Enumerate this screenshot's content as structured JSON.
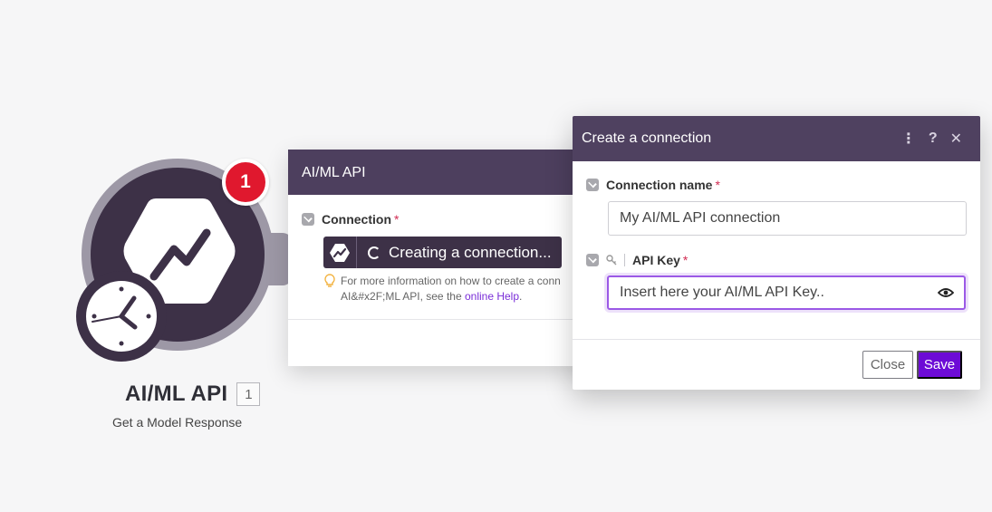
{
  "module": {
    "title": "AI/ML API",
    "subtitle": "Get a Model Response",
    "badge": "1",
    "count": "1",
    "icon": "aiml-hexagon-icon",
    "clock_icon": "clock-icon"
  },
  "panel": {
    "title": "AI/ML API",
    "connection_label": "Connection",
    "required_mark": "*",
    "connection_status": "Creating a connection...",
    "hint_text": "For more information on how to create a conn",
    "hint_text_2": "AI&#x2F;ML API, see the ",
    "hint_link": "online Help",
    "hint_end": "."
  },
  "dialog": {
    "title": "Create a connection",
    "connection_name_label": "Connection name",
    "connection_name_value": "My AI/ML API connection",
    "api_key_label": "API Key",
    "api_key_placeholder": "Insert here your AI/ML API Key..",
    "close_label": "Close",
    "save_label": "Save",
    "menu_icon": "⋮",
    "help_icon": "?",
    "close_icon": "✕"
  },
  "colors": {
    "header": "#4f4160",
    "accent": "#6d0bd6",
    "badge": "#e0182e",
    "focus": "#9b59e6"
  }
}
